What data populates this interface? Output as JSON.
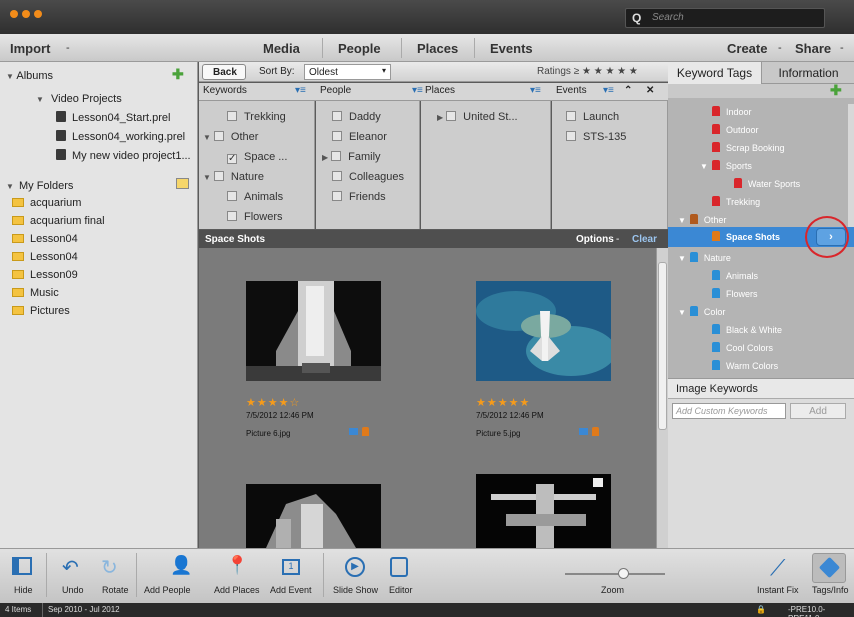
{
  "search": {
    "placeholder": "Search"
  },
  "menubar": {
    "import": "Import",
    "media": "Media",
    "people": "People",
    "places": "Places",
    "events": "Events",
    "create": "Create",
    "share": "Share",
    "dash": "-"
  },
  "albums": {
    "title": "Albums",
    "group": "Video Projects",
    "items": [
      "Lesson04_Start.prel",
      "Lesson04_working.prel",
      "My new video project1..."
    ]
  },
  "folders": {
    "title": "My Folders",
    "items": [
      "acquarium",
      "acquarium final",
      "Lesson04",
      "Lesson04",
      "Lesson09",
      "Music",
      "Pictures"
    ]
  },
  "filterbar": {
    "back": "Back",
    "sort_label": "Sort By:",
    "sort_value": "Oldest",
    "ratings": "Ratings ≥ ★ ★ ★ ★ ★"
  },
  "facets": {
    "keywords": {
      "label": "Keywords",
      "items": [
        "Trekking",
        "Other",
        "Space ...",
        "Nature",
        "Animals",
        "Flowers"
      ]
    },
    "people": {
      "label": "People",
      "items": [
        "Daddy",
        "Eleanor",
        "Family",
        "Colleagues",
        "Friends"
      ]
    },
    "places": {
      "label": "Places",
      "items": [
        "United St..."
      ]
    },
    "events": {
      "label": "Events",
      "items": [
        "Launch",
        "STS-135"
      ]
    }
  },
  "grid": {
    "title": "Space Shots",
    "options": "Options",
    "clear": "Clear",
    "items": [
      {
        "stars": "★★★★☆",
        "date": "7/5/2012 12:46 PM",
        "file": "Picture 6.jpg"
      },
      {
        "stars": "★★★★★",
        "date": "7/5/2012 12:46 PM",
        "file": "Picture 5.jpg"
      }
    ]
  },
  "right": {
    "tab_keywords": "Keyword Tags",
    "tab_info": "Information",
    "tree": [
      {
        "label": "Indoor",
        "color": "#d9262b"
      },
      {
        "label": "Outdoor",
        "color": "#d9262b"
      },
      {
        "label": "Scrap Booking",
        "color": "#d9262b"
      },
      {
        "label": "Sports",
        "color": "#d9262b"
      },
      {
        "label": "Water Sports",
        "color": "#d9262b"
      },
      {
        "label": "Trekking",
        "color": "#d9262b"
      },
      {
        "label": "Other",
        "color": "#b05a1e"
      },
      {
        "label": "Space Shots",
        "color": "#e07a1a"
      },
      {
        "label": "Nature",
        "color": "#2a8fd6"
      },
      {
        "label": "Animals",
        "color": "#2a8fd6"
      },
      {
        "label": "Flowers",
        "color": "#2a8fd6"
      },
      {
        "label": "Color",
        "color": "#2a8fd6"
      },
      {
        "label": "Black & White",
        "color": "#2a8fd6"
      },
      {
        "label": "Cool Colors",
        "color": "#2a8fd6"
      },
      {
        "label": "Warm Colors",
        "color": "#2a8fd6"
      }
    ],
    "image_keywords": "Image Keywords",
    "custom_placeholder": "Add Custom Keywords",
    "add": "Add"
  },
  "toolbar": {
    "hide": "Hide",
    "undo": "Undo",
    "rotate": "Rotate",
    "add_people": "Add People",
    "add_places": "Add Places",
    "add_event": "Add Event",
    "slide_show": "Slide Show",
    "editor": "Editor",
    "zoom": "Zoom",
    "instant_fix": "Instant Fix",
    "tags_info": "Tags/Info"
  },
  "status": {
    "items": "4 Items",
    "range": "Sep 2010 - Jul 2012",
    "version": "-PRE10.0-PRE11.0"
  }
}
